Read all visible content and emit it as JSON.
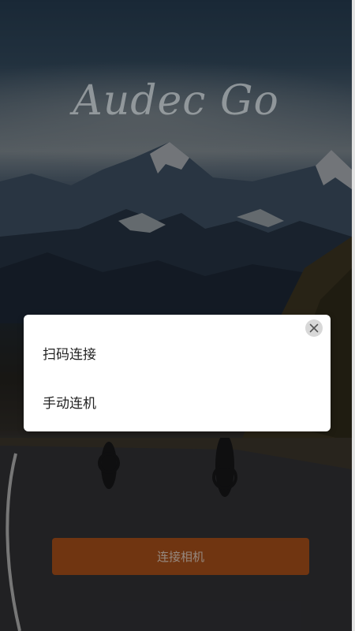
{
  "app": {
    "logo_text": "Audec Go"
  },
  "connect_button": {
    "label": "连接相机"
  },
  "dialog": {
    "options": [
      {
        "label": "扫码连接"
      },
      {
        "label": "手动连机"
      }
    ],
    "close_icon": "close-icon"
  },
  "colors": {
    "accent": "#b5551c",
    "dialog_bg": "#ffffff",
    "close_bg": "#d8d8d8"
  }
}
